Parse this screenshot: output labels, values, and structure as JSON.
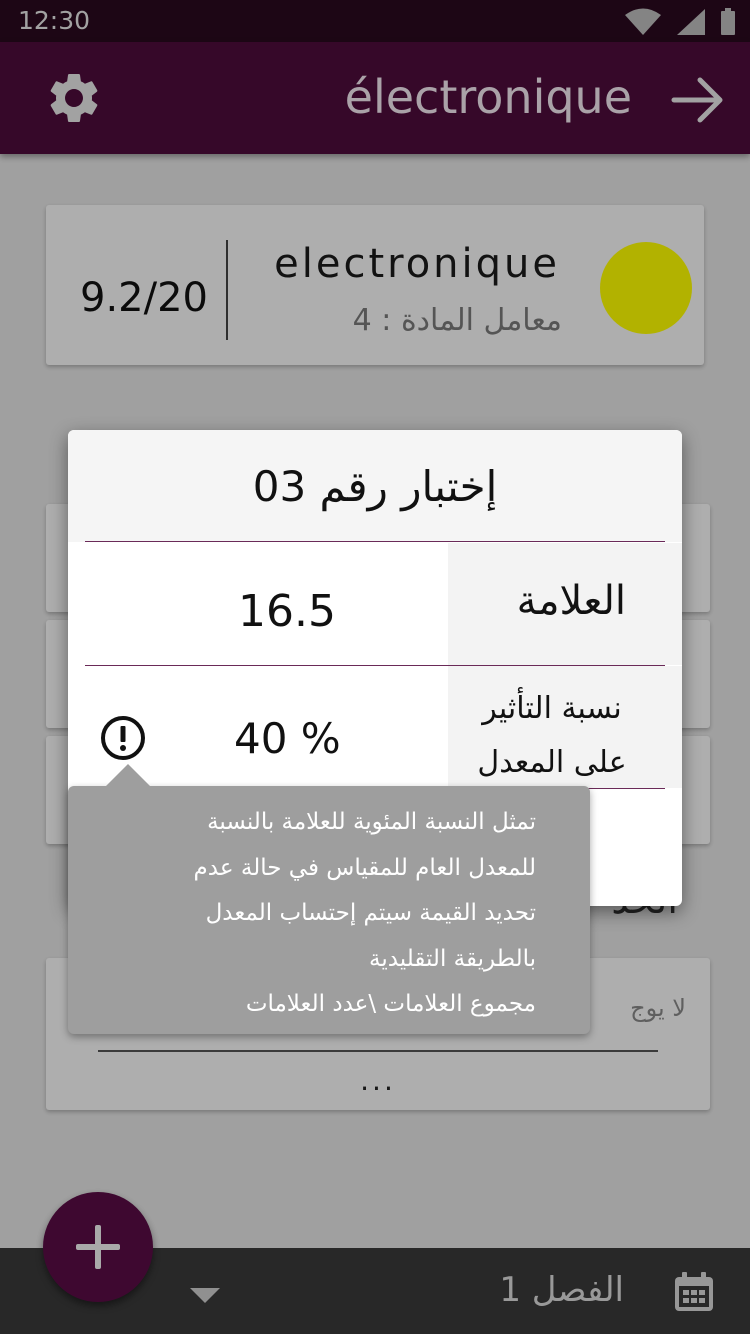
{
  "status_bar": {
    "time": "12:30"
  },
  "app_bar": {
    "title": "électronique"
  },
  "subject_card": {
    "name": "electronique",
    "coefficient": "معامل المادة : 4",
    "grade": "9.2/20",
    "color": "#ffff00"
  },
  "background": {
    "section_label": "الحد",
    "notes_empty": "لا يوج",
    "notes_more": "..."
  },
  "dialog": {
    "title": "إختبار رقم 03",
    "mark_label": "العلامة",
    "mark_value": "16.5",
    "weight_label_line1": "نسبة التأثير",
    "weight_label_line2": "على المعدل",
    "weight_value": "40 %"
  },
  "tooltip": {
    "lines": [
      "تمثل النسبة المئوية للعلامة بالنسبة",
      "للمعدل العام للمقياس في حالة عدم",
      "تحديد القيمة سيتم إحتساب المعدل",
      "بالطريقة التقليدية",
      "مجموع العلامات \\عدد العلامات"
    ]
  },
  "bottom_bar": {
    "semester": "الفصل 1"
  },
  "colors": {
    "primary": "#4e0c3c",
    "fab": "#5a0c46",
    "accent_line": "#6a2a58"
  }
}
